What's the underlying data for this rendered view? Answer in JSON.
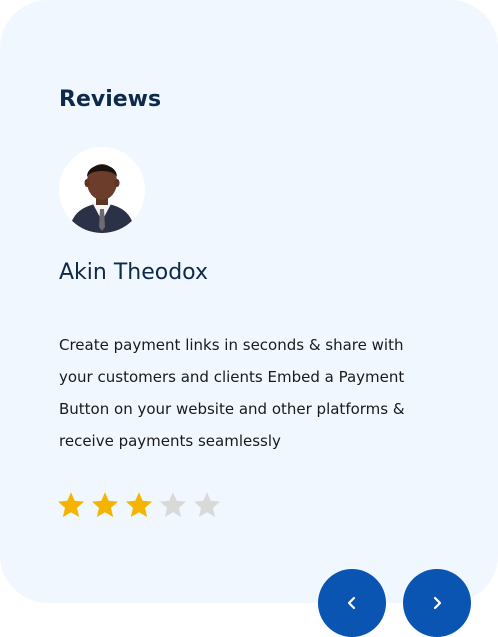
{
  "reviews": {
    "title": "Reviews",
    "reviewer": {
      "name": "Akin Theodox",
      "avatar_icon": "person-photo"
    },
    "text": "Create payment links in seconds & share with your customers and clients Embed a Payment Button on your website and other platforms & receive payments seamlessly",
    "rating": {
      "value": 3,
      "max": 5,
      "filled_color": "#f5b400",
      "empty_color": "#d9d9d9"
    }
  },
  "navigation": {
    "prev_icon": "chevron-left-icon",
    "next_icon": "chevron-right-icon",
    "button_color": "#0a55b1"
  },
  "colors": {
    "card_background": "#f0f7fe",
    "heading": "#0e2a4a"
  }
}
